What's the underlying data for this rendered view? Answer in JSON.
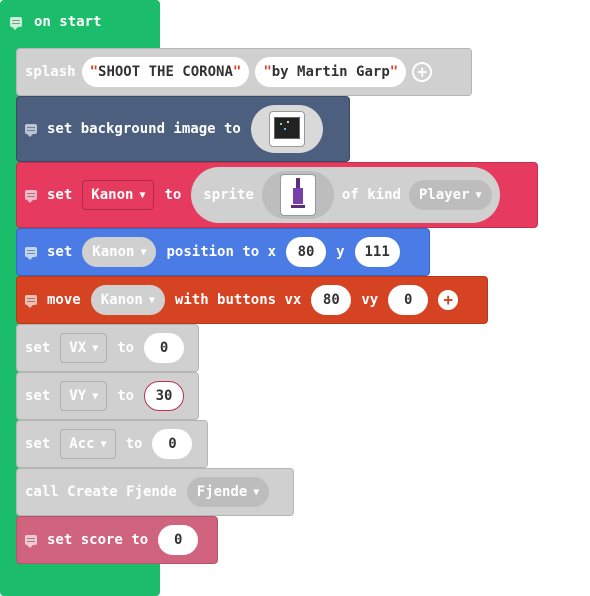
{
  "colors": {
    "event": "#1bbd6b",
    "scene": "#4c5f7e",
    "sprite": "#e63b5f",
    "position": "#4b7be5",
    "controller": "#d54322",
    "variable": "#d0d0d0",
    "info": "#d0647f"
  },
  "on_start": {
    "label": "on start"
  },
  "splash": {
    "label": "splash",
    "title": "SHOOT THE CORONA",
    "subtitle": "by Martin Garp",
    "title_quote_open": "\"",
    "title_quote_close": "\"",
    "subtitle_quote_open": "\"",
    "subtitle_quote_close": "\""
  },
  "background": {
    "label": "set background image to",
    "image": "starfield-image"
  },
  "set_sprite": {
    "set_label": "set",
    "variable": "Kanon",
    "to_label": "to",
    "sprite_label": "sprite",
    "sprite_image": "syringe-image",
    "kind_label": "of kind",
    "kind": "Player"
  },
  "set_position": {
    "set_label": "set",
    "variable": "Kanon",
    "position_label": "position to x",
    "x": "80",
    "y_label": "y",
    "y": "111"
  },
  "move": {
    "move_label": "move",
    "variable": "Kanon",
    "buttons_label": "with buttons vx",
    "vx": "80",
    "vy_label": "vy",
    "vy": "0"
  },
  "set_vx": {
    "set_label": "set",
    "variable": "VX",
    "to_label": "to",
    "value": "0"
  },
  "set_vy": {
    "set_label": "set",
    "variable": "VY",
    "to_label": "to",
    "value": "30"
  },
  "set_acc": {
    "set_label": "set",
    "variable": "Acc",
    "to_label": "to",
    "value": "0"
  },
  "call": {
    "label": "call Create Fjende",
    "function": "Fjende"
  },
  "set_score": {
    "label": "set score to",
    "value": "0"
  },
  "caret": "▼"
}
